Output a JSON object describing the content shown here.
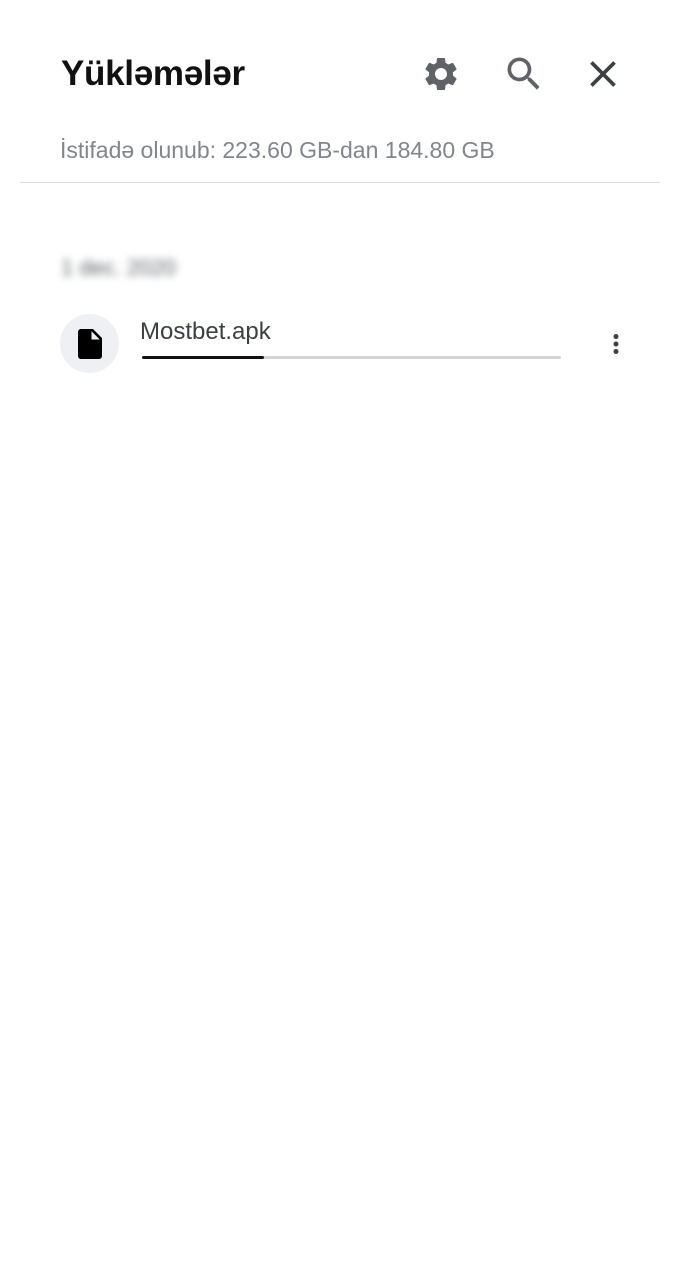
{
  "header": {
    "title": "Yükləmələr",
    "settings_icon": "gear-icon",
    "search_icon": "search-icon",
    "close_icon": "close-icon"
  },
  "storage": {
    "text": "İstifadə olunub: 223.60 GB-dan 184.80 GB"
  },
  "downloads": {
    "date_header": "1 dec. 2020",
    "items": [
      {
        "name": "Mostbet.apk",
        "icon": "file-icon",
        "progress": 0.29,
        "menu_icon": "more-vert-icon"
      }
    ]
  },
  "colors": {
    "title": "#111111",
    "secondary_text": "#80868b",
    "divider": "#dadce0",
    "avatar_bg": "#eff0f4",
    "progress_fill": "#111111",
    "progress_track": "#d3d4d7",
    "icons": "#5f6368"
  }
}
